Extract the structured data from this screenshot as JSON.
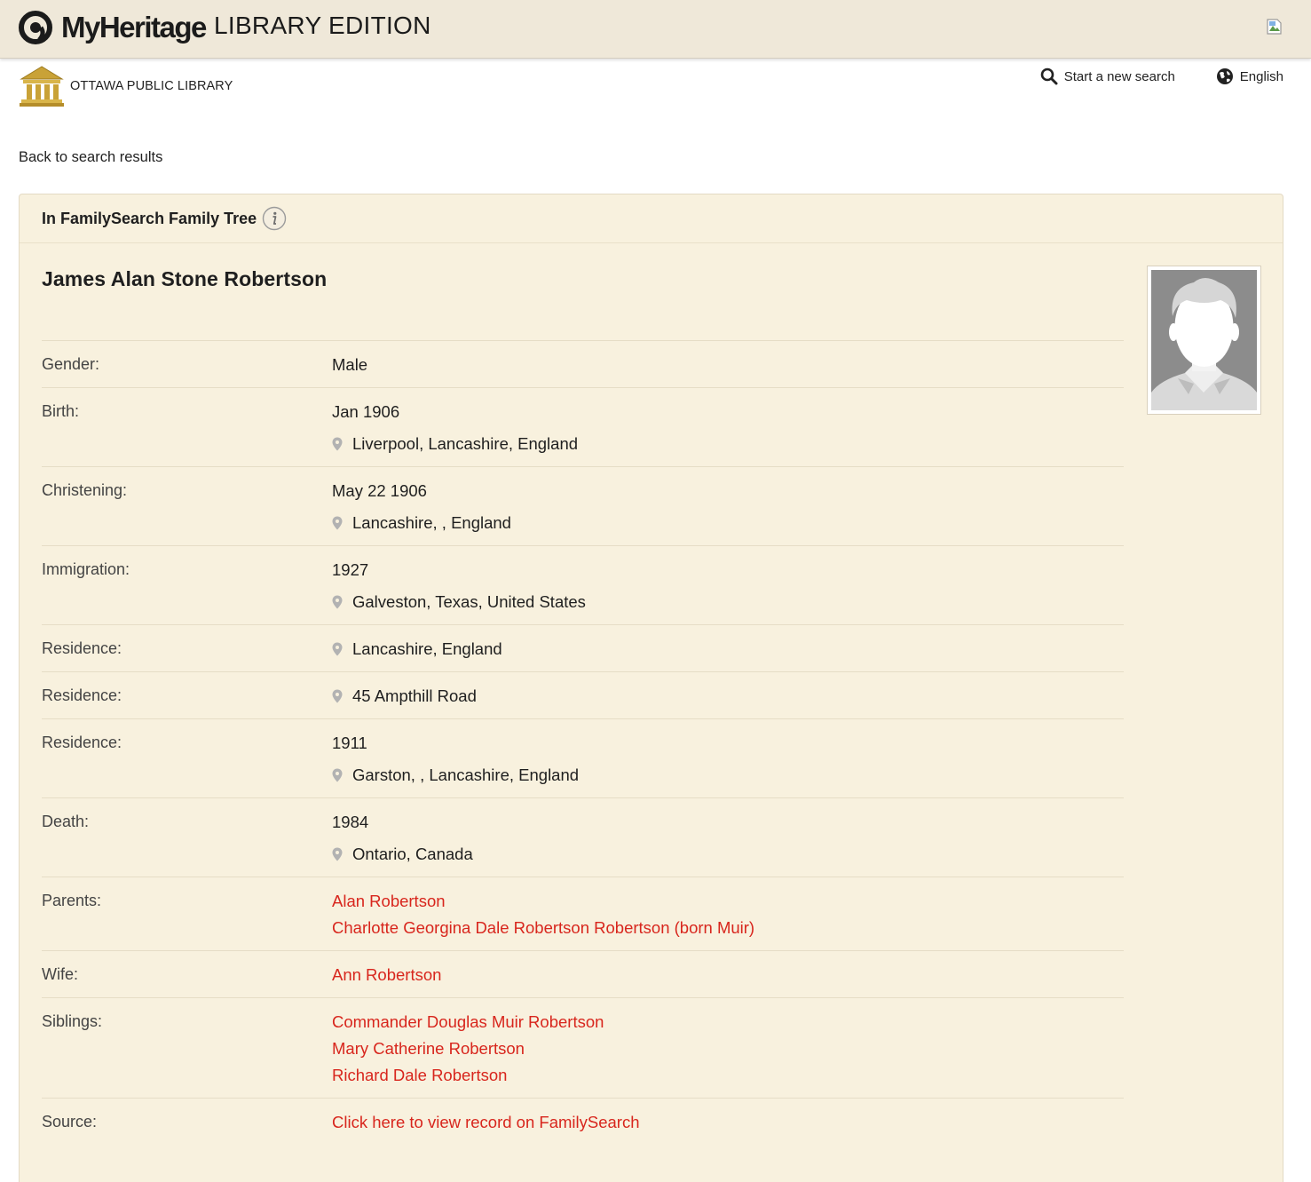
{
  "header": {
    "brand": "MyHeritage",
    "edition": "LIBRARY EDITION"
  },
  "library": {
    "name": "OTTAWA PUBLIC LIBRARY"
  },
  "toplinks": {
    "search": "Start a new search",
    "language": "English"
  },
  "back_link": "Back to search results",
  "panel": {
    "title": "In FamilySearch Family Tree",
    "person_name": "James Alan Stone Robertson"
  },
  "facts": [
    {
      "label": "Gender:",
      "value": "Male"
    },
    {
      "label": "Birth:",
      "date": "Jan 1906",
      "place": "Liverpool, Lancashire, England"
    },
    {
      "label": "Christening:",
      "date": "May 22 1906",
      "place": "Lancashire, , England"
    },
    {
      "label": "Immigration:",
      "date": "1927",
      "place": "Galveston, Texas, United States"
    },
    {
      "label": "Residence:",
      "place": "Lancashire, England"
    },
    {
      "label": "Residence:",
      "place": "45 Ampthill Road"
    },
    {
      "label": "Residence:",
      "date": "1911",
      "place": "Garston, , Lancashire, England"
    },
    {
      "label": "Death:",
      "date": "1984",
      "place": "Ontario, Canada"
    }
  ],
  "relatives": {
    "parents_label": "Parents:",
    "parents": [
      "Alan Robertson",
      "Charlotte Georgina Dale Robertson Robertson (born Muir)"
    ],
    "wife_label": "Wife:",
    "wife": [
      "Ann Robertson"
    ],
    "siblings_label": "Siblings:",
    "siblings": [
      "Commander Douglas Muir Robertson",
      "Mary Catherine Robertson",
      "Richard Dale Robertson"
    ],
    "source_label": "Source:",
    "source": "Click here to view record on FamilySearch"
  },
  "colors": {
    "header_bg": "#efe8d9",
    "panel_bg": "#f8f1de",
    "link": "#d8261d",
    "gold": "#c9a237"
  }
}
